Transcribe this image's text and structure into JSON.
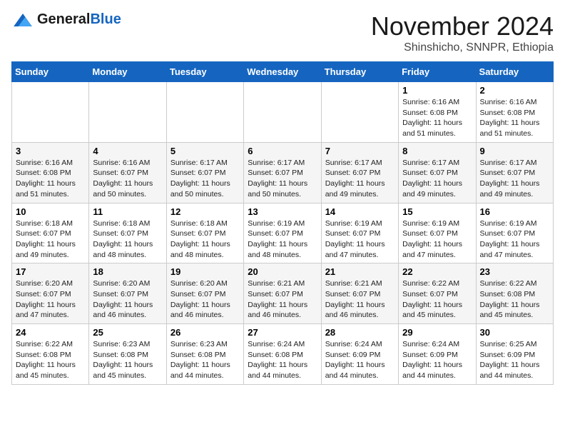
{
  "header": {
    "logo_line1": "General",
    "logo_line2": "Blue",
    "month": "November 2024",
    "location": "Shinshicho, SNNPR, Ethiopia"
  },
  "weekdays": [
    "Sunday",
    "Monday",
    "Tuesday",
    "Wednesday",
    "Thursday",
    "Friday",
    "Saturday"
  ],
  "weeks": [
    [
      {
        "day": "",
        "info": ""
      },
      {
        "day": "",
        "info": ""
      },
      {
        "day": "",
        "info": ""
      },
      {
        "day": "",
        "info": ""
      },
      {
        "day": "",
        "info": ""
      },
      {
        "day": "1",
        "info": "Sunrise: 6:16 AM\nSunset: 6:08 PM\nDaylight: 11 hours\nand 51 minutes."
      },
      {
        "day": "2",
        "info": "Sunrise: 6:16 AM\nSunset: 6:08 PM\nDaylight: 11 hours\nand 51 minutes."
      }
    ],
    [
      {
        "day": "3",
        "info": "Sunrise: 6:16 AM\nSunset: 6:08 PM\nDaylight: 11 hours\nand 51 minutes."
      },
      {
        "day": "4",
        "info": "Sunrise: 6:16 AM\nSunset: 6:07 PM\nDaylight: 11 hours\nand 50 minutes."
      },
      {
        "day": "5",
        "info": "Sunrise: 6:17 AM\nSunset: 6:07 PM\nDaylight: 11 hours\nand 50 minutes."
      },
      {
        "day": "6",
        "info": "Sunrise: 6:17 AM\nSunset: 6:07 PM\nDaylight: 11 hours\nand 50 minutes."
      },
      {
        "day": "7",
        "info": "Sunrise: 6:17 AM\nSunset: 6:07 PM\nDaylight: 11 hours\nand 49 minutes."
      },
      {
        "day": "8",
        "info": "Sunrise: 6:17 AM\nSunset: 6:07 PM\nDaylight: 11 hours\nand 49 minutes."
      },
      {
        "day": "9",
        "info": "Sunrise: 6:17 AM\nSunset: 6:07 PM\nDaylight: 11 hours\nand 49 minutes."
      }
    ],
    [
      {
        "day": "10",
        "info": "Sunrise: 6:18 AM\nSunset: 6:07 PM\nDaylight: 11 hours\nand 49 minutes."
      },
      {
        "day": "11",
        "info": "Sunrise: 6:18 AM\nSunset: 6:07 PM\nDaylight: 11 hours\nand 48 minutes."
      },
      {
        "day": "12",
        "info": "Sunrise: 6:18 AM\nSunset: 6:07 PM\nDaylight: 11 hours\nand 48 minutes."
      },
      {
        "day": "13",
        "info": "Sunrise: 6:19 AM\nSunset: 6:07 PM\nDaylight: 11 hours\nand 48 minutes."
      },
      {
        "day": "14",
        "info": "Sunrise: 6:19 AM\nSunset: 6:07 PM\nDaylight: 11 hours\nand 47 minutes."
      },
      {
        "day": "15",
        "info": "Sunrise: 6:19 AM\nSunset: 6:07 PM\nDaylight: 11 hours\nand 47 minutes."
      },
      {
        "day": "16",
        "info": "Sunrise: 6:19 AM\nSunset: 6:07 PM\nDaylight: 11 hours\nand 47 minutes."
      }
    ],
    [
      {
        "day": "17",
        "info": "Sunrise: 6:20 AM\nSunset: 6:07 PM\nDaylight: 11 hours\nand 47 minutes."
      },
      {
        "day": "18",
        "info": "Sunrise: 6:20 AM\nSunset: 6:07 PM\nDaylight: 11 hours\nand 46 minutes."
      },
      {
        "day": "19",
        "info": "Sunrise: 6:20 AM\nSunset: 6:07 PM\nDaylight: 11 hours\nand 46 minutes."
      },
      {
        "day": "20",
        "info": "Sunrise: 6:21 AM\nSunset: 6:07 PM\nDaylight: 11 hours\nand 46 minutes."
      },
      {
        "day": "21",
        "info": "Sunrise: 6:21 AM\nSunset: 6:07 PM\nDaylight: 11 hours\nand 46 minutes."
      },
      {
        "day": "22",
        "info": "Sunrise: 6:22 AM\nSunset: 6:07 PM\nDaylight: 11 hours\nand 45 minutes."
      },
      {
        "day": "23",
        "info": "Sunrise: 6:22 AM\nSunset: 6:08 PM\nDaylight: 11 hours\nand 45 minutes."
      }
    ],
    [
      {
        "day": "24",
        "info": "Sunrise: 6:22 AM\nSunset: 6:08 PM\nDaylight: 11 hours\nand 45 minutes."
      },
      {
        "day": "25",
        "info": "Sunrise: 6:23 AM\nSunset: 6:08 PM\nDaylight: 11 hours\nand 45 minutes."
      },
      {
        "day": "26",
        "info": "Sunrise: 6:23 AM\nSunset: 6:08 PM\nDaylight: 11 hours\nand 44 minutes."
      },
      {
        "day": "27",
        "info": "Sunrise: 6:24 AM\nSunset: 6:08 PM\nDaylight: 11 hours\nand 44 minutes."
      },
      {
        "day": "28",
        "info": "Sunrise: 6:24 AM\nSunset: 6:09 PM\nDaylight: 11 hours\nand 44 minutes."
      },
      {
        "day": "29",
        "info": "Sunrise: 6:24 AM\nSunset: 6:09 PM\nDaylight: 11 hours\nand 44 minutes."
      },
      {
        "day": "30",
        "info": "Sunrise: 6:25 AM\nSunset: 6:09 PM\nDaylight: 11 hours\nand 44 minutes."
      }
    ]
  ]
}
